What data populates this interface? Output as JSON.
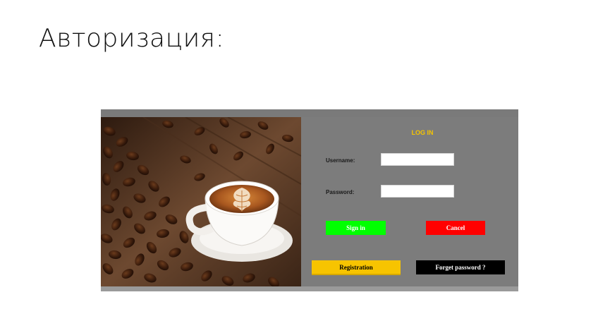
{
  "slide": {
    "title": "Авторизация:"
  },
  "window": {
    "photo_alt": "Coffee cup with latte art and roasted coffee beans",
    "login_title": "LOG IN",
    "username": {
      "label": "Username:",
      "value": ""
    },
    "password": {
      "label": "Password:",
      "value": ""
    },
    "buttons": {
      "sign_in": "Sign in",
      "cancel": "Cancel",
      "registration": "Registration",
      "forget_password": "Forget password ?"
    }
  },
  "colors": {
    "panel_gray": "#7c7c7c",
    "title_yellow": "#f5c400",
    "sign_in_green": "#00ff00",
    "cancel_red": "#ff0000",
    "registration_yellow": "#f7c400",
    "forget_black": "#000000"
  }
}
